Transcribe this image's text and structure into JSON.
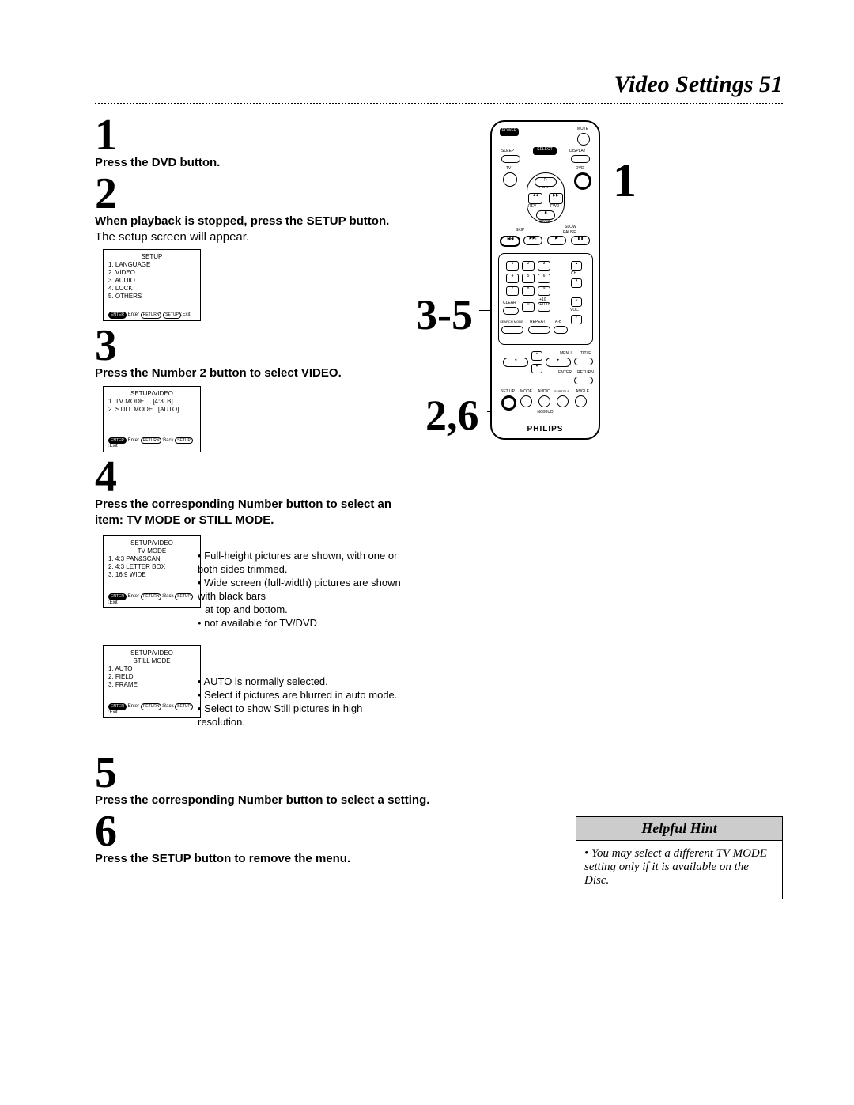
{
  "header": {
    "title": "Video Settings 51"
  },
  "steps": {
    "n1": "1",
    "s1_bold": "Press the DVD button.",
    "n2": "2",
    "s2_bold": "When playback is stopped, press the SETUP button. ",
    "s2_reg": "The setup screen will appear.",
    "n3": "3",
    "s3_bold": "Press the Number 2 button to select VIDEO.",
    "n4": "4",
    "s4_bold": "Press the corresponding Number button to select an item: TV MODE or STILL MODE.",
    "n5": "5",
    "s5_bold": "Press the corresponding Number button to select a setting.",
    "n6": "6",
    "s6_bold": "Press the SETUP button to remove the menu."
  },
  "screens": {
    "setup": {
      "title": "SETUP",
      "items": [
        "1. LANGUAGE",
        "2. VIDEO",
        "3. AUDIO",
        "4. LOCK",
        "5. OTHERS"
      ],
      "foot_enter": "ENTER",
      "foot_enter_txt": ":Enter",
      "foot_return": "RETURN",
      "foot_setup": "SETUP",
      "foot_exit": ":Exit"
    },
    "video": {
      "title": "SETUP/VIDEO",
      "r1l": "1. TV MODE",
      "r1r": "[4:3LB]",
      "r2l": "2. STILL MODE",
      "r2r": "[AUTO]",
      "foot_enter": "ENTER",
      "foot_enter_txt": ":Enter",
      "foot_return": "RETURN",
      "foot_back": ":Back",
      "foot_setup": "SETUP",
      "foot_exit": ":Exit"
    },
    "tvmode": {
      "title1": "SETUP/VIDEO",
      "title2": "TV MODE",
      "items": [
        "1. 4:3 PAN&SCAN",
        "2. 4:3 LETTER BOX",
        "3. 16:9 WIDE"
      ],
      "foot_enter": "ENTER",
      "foot_enter_txt": ":Enter",
      "foot_return": "RETURN",
      "foot_back": ":Back",
      "foot_setup": "SETUP",
      "foot_exit": ":Exit"
    },
    "stillmode": {
      "title1": "SETUP/VIDEO",
      "title2": "STILL MODE",
      "items": [
        "1. AUTO",
        "2. FIELD",
        "3. FRAME"
      ],
      "foot_enter": "ENTER",
      "foot_enter_txt": ":Enter",
      "foot_return": "RETURN",
      "foot_back": ":Back",
      "foot_setup": "SETUP",
      "foot_exit": ":Exit"
    }
  },
  "annotations": {
    "tv1": "• Full-height pictures are shown, with one or both sides trimmed.",
    "tv2a": "• Wide screen (full-width) pictures are shown with black bars",
    "tv2b": "at top and bottom.",
    "tv3": "• not available for TV/DVD",
    "st1": "• AUTO is normally selected.",
    "st2": "• Select if pictures are blurred in auto mode.",
    "st3": "• Select to show Still pictures in high resolution."
  },
  "callouts": {
    "c1": "1",
    "c35": "3-5",
    "c26": "2,6"
  },
  "hint": {
    "head": "Helpful Hint",
    "body": "• You may select a different TV MODE setting only if it is available on the Disc."
  },
  "remote": {
    "power": "POWER",
    "mute": "MUTE",
    "sleep": "SLEEP",
    "select": "SELECT",
    "display": "DISPLAY",
    "tv": "TV",
    "dvd": "DVD",
    "play": "PLAY",
    "rev": "REV",
    "fwd": "FWD",
    "stop": "STOP",
    "skip": "SKIP",
    "slow": "SLOW",
    "pause": "PAUSE",
    "k1": "1",
    "k2": "2",
    "k3": "3",
    "k4": "4",
    "k5": "5",
    "k6": "6",
    "k7": "7",
    "k8": "8",
    "k9": "9",
    "k0": "0",
    "clear": "CLEAR",
    "plus10": "+10",
    "plus100": "+100",
    "ch": "CH.",
    "vol": "VOL.",
    "searchmode": "SEARCH MODE",
    "repeat": "REPEAT",
    "ab": "A-B",
    "menu": "MENU",
    "title": "TITLE",
    "enter": "ENTER",
    "return": "RETURN",
    "setup": "SET UP",
    "mode": "MODE",
    "audio": "AUDIO",
    "subtitle": "SUBTITLE",
    "angle": "ANGLE",
    "model": "NG98UD",
    "brand": "PHILIPS"
  }
}
